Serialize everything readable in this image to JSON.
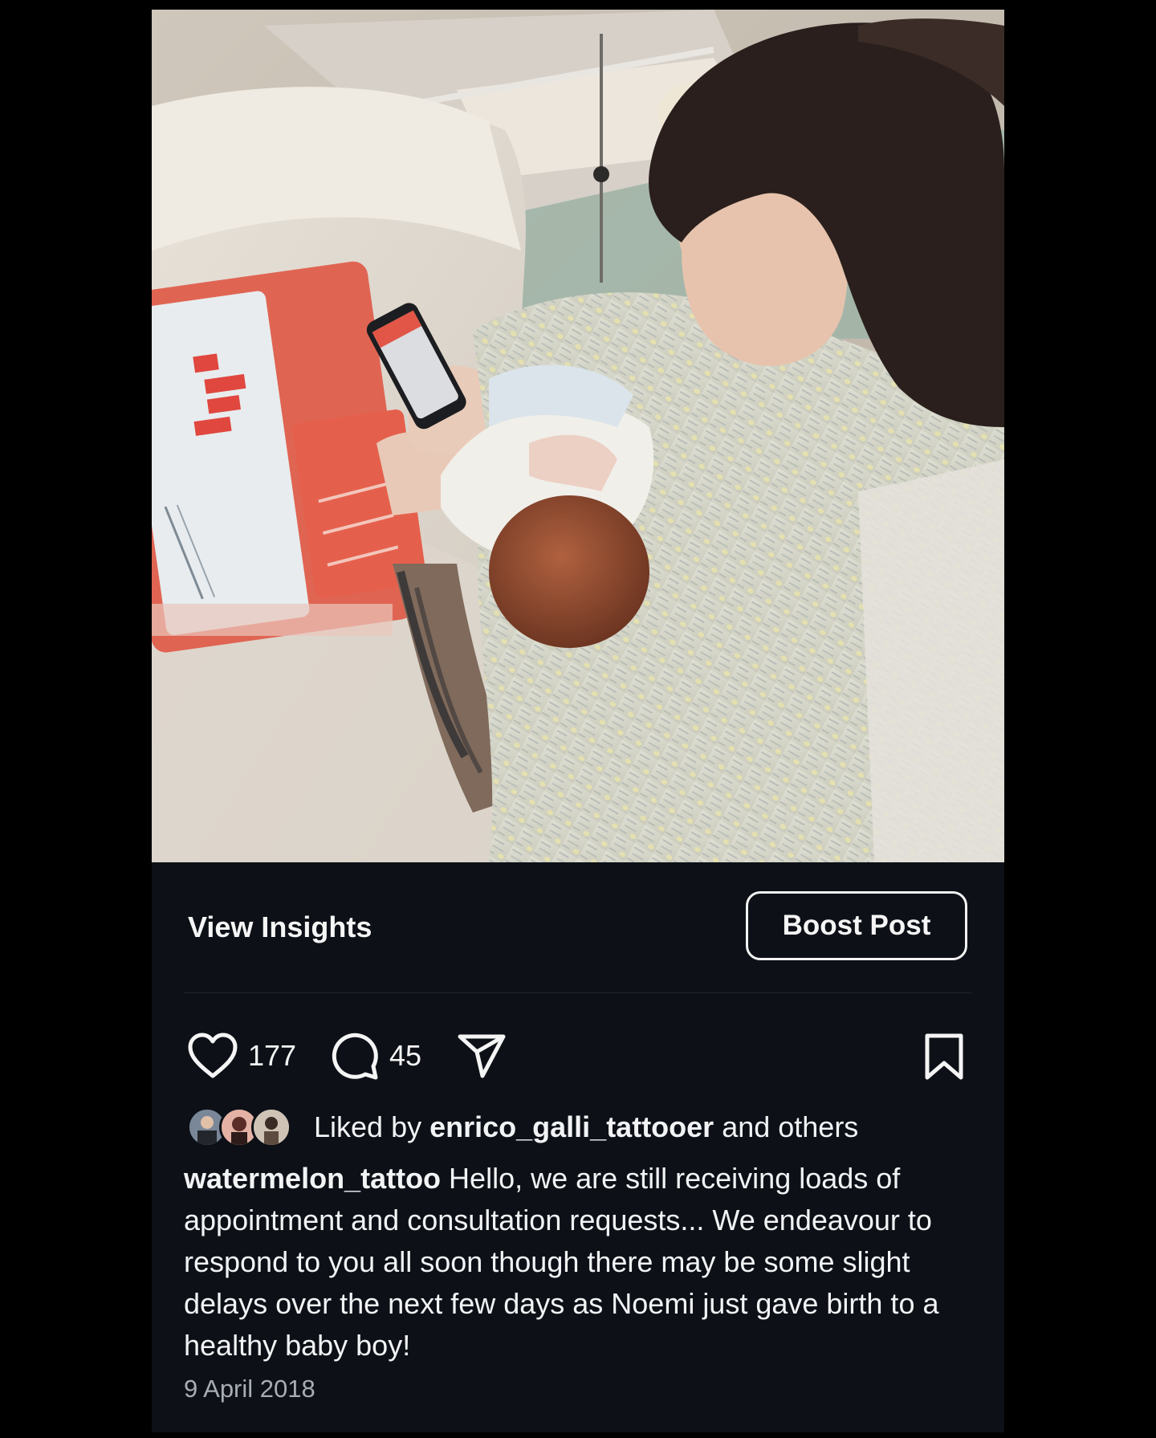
{
  "post": {
    "photo_alt": "photo"
  },
  "insights": {
    "view_label": "View Insights",
    "boost_label": "Boost Post"
  },
  "actions": {
    "likes": "177",
    "comments": "45"
  },
  "likes_row": {
    "prefix": "Liked by ",
    "user": "enrico_galli_tattooer",
    "suffix": " and others"
  },
  "caption": {
    "username": "watermelon_tattoo",
    "text": " Hello, we are still receiving loads of appointment and consultation requests... We endeavour to respond to you all soon though there may be some slight delays over the next few days as Noemi just gave birth to a healthy baby boy!"
  },
  "date": "9 April 2018",
  "colors": {
    "background": "#000000",
    "card": "#0d1117",
    "text": "#f2f3f5",
    "muted": "#a8adb4"
  },
  "icons": {
    "like": "heart-icon",
    "comment": "comment-bubble-icon",
    "share": "paper-plane-icon",
    "save": "bookmark-icon"
  }
}
